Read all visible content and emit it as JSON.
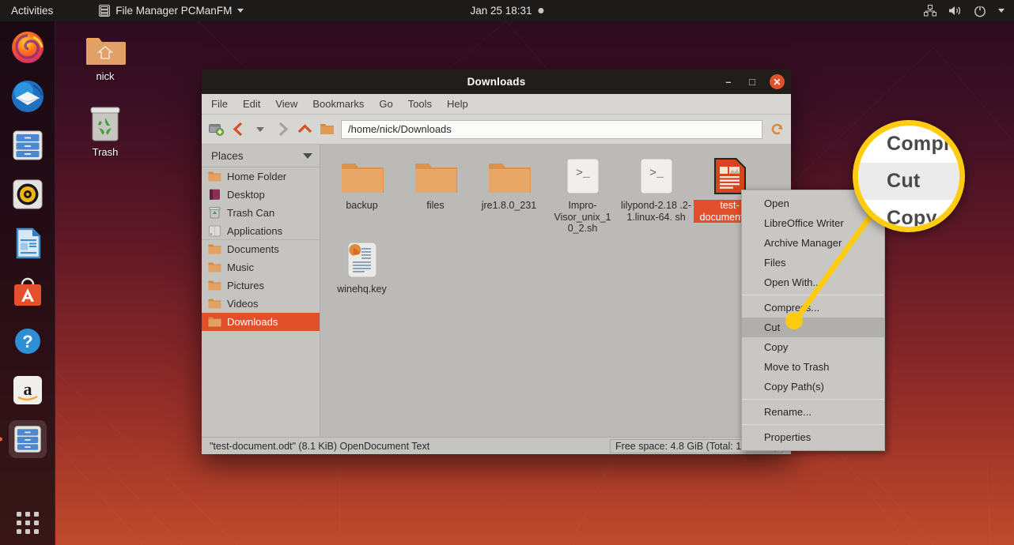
{
  "topbar": {
    "activities": "Activities",
    "app_icon": "file-manager-icon",
    "app_name": "File Manager PCManFM",
    "clock": "Jan 25  18:31",
    "tray_icons": [
      "network-icon",
      "volume-icon",
      "power-icon",
      "chevron-down-icon"
    ]
  },
  "dock": {
    "items": [
      {
        "name": "firefox",
        "icon": "firefox-icon",
        "running": false
      },
      {
        "name": "thunderbird",
        "icon": "thunderbird-mail-icon",
        "running": false
      },
      {
        "name": "files-nautilus",
        "icon": "files-cabinet-icon",
        "running": false
      },
      {
        "name": "rhythmbox",
        "icon": "rhythmbox-speaker-icon",
        "running": false
      },
      {
        "name": "libreoffice-writer",
        "icon": "libreoffice-writer-icon",
        "running": false
      },
      {
        "name": "ubuntu-software",
        "icon": "ubuntu-software-bag-icon",
        "running": false
      },
      {
        "name": "help",
        "icon": "help-question-icon",
        "running": false
      },
      {
        "name": "amazon",
        "icon": "amazon-a-icon",
        "running": false
      },
      {
        "name": "pcmanfm",
        "icon": "files-cabinet-icon",
        "running": true
      }
    ],
    "show_apps": "show-applications-grid-icon"
  },
  "desktop": {
    "icons": [
      {
        "label": "nick",
        "icon": "home-folder-icon"
      },
      {
        "label": "Trash",
        "icon": "trash-can-icon"
      }
    ]
  },
  "window": {
    "title": "Downloads",
    "buttons": {
      "minimize": "–",
      "maximize": "□",
      "close": "✕"
    },
    "menubar": [
      "File",
      "Edit",
      "View",
      "Bookmarks",
      "Go",
      "Tools",
      "Help"
    ],
    "toolbar": {
      "icons": [
        "new-tab-icon",
        "back-icon",
        "history-dropdown-icon",
        "forward-icon",
        "up-icon",
        "home-folder-icon"
      ],
      "path": "/home/nick/Downloads",
      "reload_icon": "reload-icon"
    },
    "sidebar": {
      "header": "Places",
      "header_icon": "chevron-down-icon",
      "items": [
        {
          "label": "Home Folder",
          "icon": "folder-icon",
          "selected": false
        },
        {
          "label": "Desktop",
          "icon": "desktop-icon",
          "selected": false
        },
        {
          "label": "Trash Can",
          "icon": "trash-icon",
          "selected": false
        },
        {
          "label": "Applications",
          "icon": "applications-icon",
          "selected": false
        },
        {
          "label": "Documents",
          "icon": "folder-icon",
          "selected": false
        },
        {
          "label": "Music",
          "icon": "folder-icon",
          "selected": false
        },
        {
          "label": "Pictures",
          "icon": "folder-icon",
          "selected": false
        },
        {
          "label": "Videos",
          "icon": "folder-icon",
          "selected": false
        },
        {
          "label": "Downloads",
          "icon": "folder-icon",
          "selected": true
        }
      ]
    },
    "files": [
      {
        "label": "backup",
        "icon": "folder-icon",
        "selected": false
      },
      {
        "label": "files",
        "icon": "folder-icon",
        "selected": false
      },
      {
        "label": "jre1.8.0_231",
        "icon": "folder-icon",
        "selected": false
      },
      {
        "label": "Impro-Visor_unix_1 0_2.sh",
        "icon": "shell-script-icon",
        "selected": false
      },
      {
        "label": "lilypond-2.18 .2-1.linux-64. sh",
        "icon": "shell-script-icon",
        "selected": false
      },
      {
        "label": "test-document.odt",
        "icon": "odt-document-icon",
        "selected": true
      },
      {
        "label": "winehq.key",
        "icon": "key-document-icon",
        "selected": false
      }
    ],
    "statusbar": {
      "left": "\"test-document.odt\" (8.1 KiB) OpenDocument Text",
      "right": "Free space: 4.8 GiB (Total: 19.6 GiB)"
    }
  },
  "context_menu": {
    "items": [
      {
        "label": "Open",
        "highlighted": false,
        "separator_after": false
      },
      {
        "label": "LibreOffice Writer",
        "highlighted": false,
        "separator_after": false
      },
      {
        "label": "Archive Manager",
        "highlighted": false,
        "separator_after": false
      },
      {
        "label": "Files",
        "highlighted": false,
        "separator_after": false
      },
      {
        "label": "Open With...",
        "highlighted": false,
        "separator_after": true
      },
      {
        "label": "Compress...",
        "highlighted": false,
        "separator_after": false
      },
      {
        "label": "Cut",
        "highlighted": true,
        "separator_after": false
      },
      {
        "label": "Copy",
        "highlighted": false,
        "separator_after": false
      },
      {
        "label": "Move to Trash",
        "highlighted": false,
        "separator_after": false
      },
      {
        "label": "Copy Path(s)",
        "highlighted": false,
        "separator_after": true
      },
      {
        "label": "Rename...",
        "highlighted": false,
        "separator_after": true
      },
      {
        "label": "Properties",
        "highlighted": false,
        "separator_after": false
      }
    ]
  },
  "magnifier": {
    "border_color": "#ffcc11",
    "rows": [
      {
        "label": "Compr",
        "highlighted": false
      },
      {
        "label": "Cut",
        "highlighted": true
      },
      {
        "label": "Copy",
        "highlighted": false
      }
    ]
  },
  "colors": {
    "accent_orange": "#e2502b",
    "highlight_yellow": "#ffcc11",
    "window_chrome": "#d8d6d3",
    "topbar": "#1d1b1a"
  }
}
